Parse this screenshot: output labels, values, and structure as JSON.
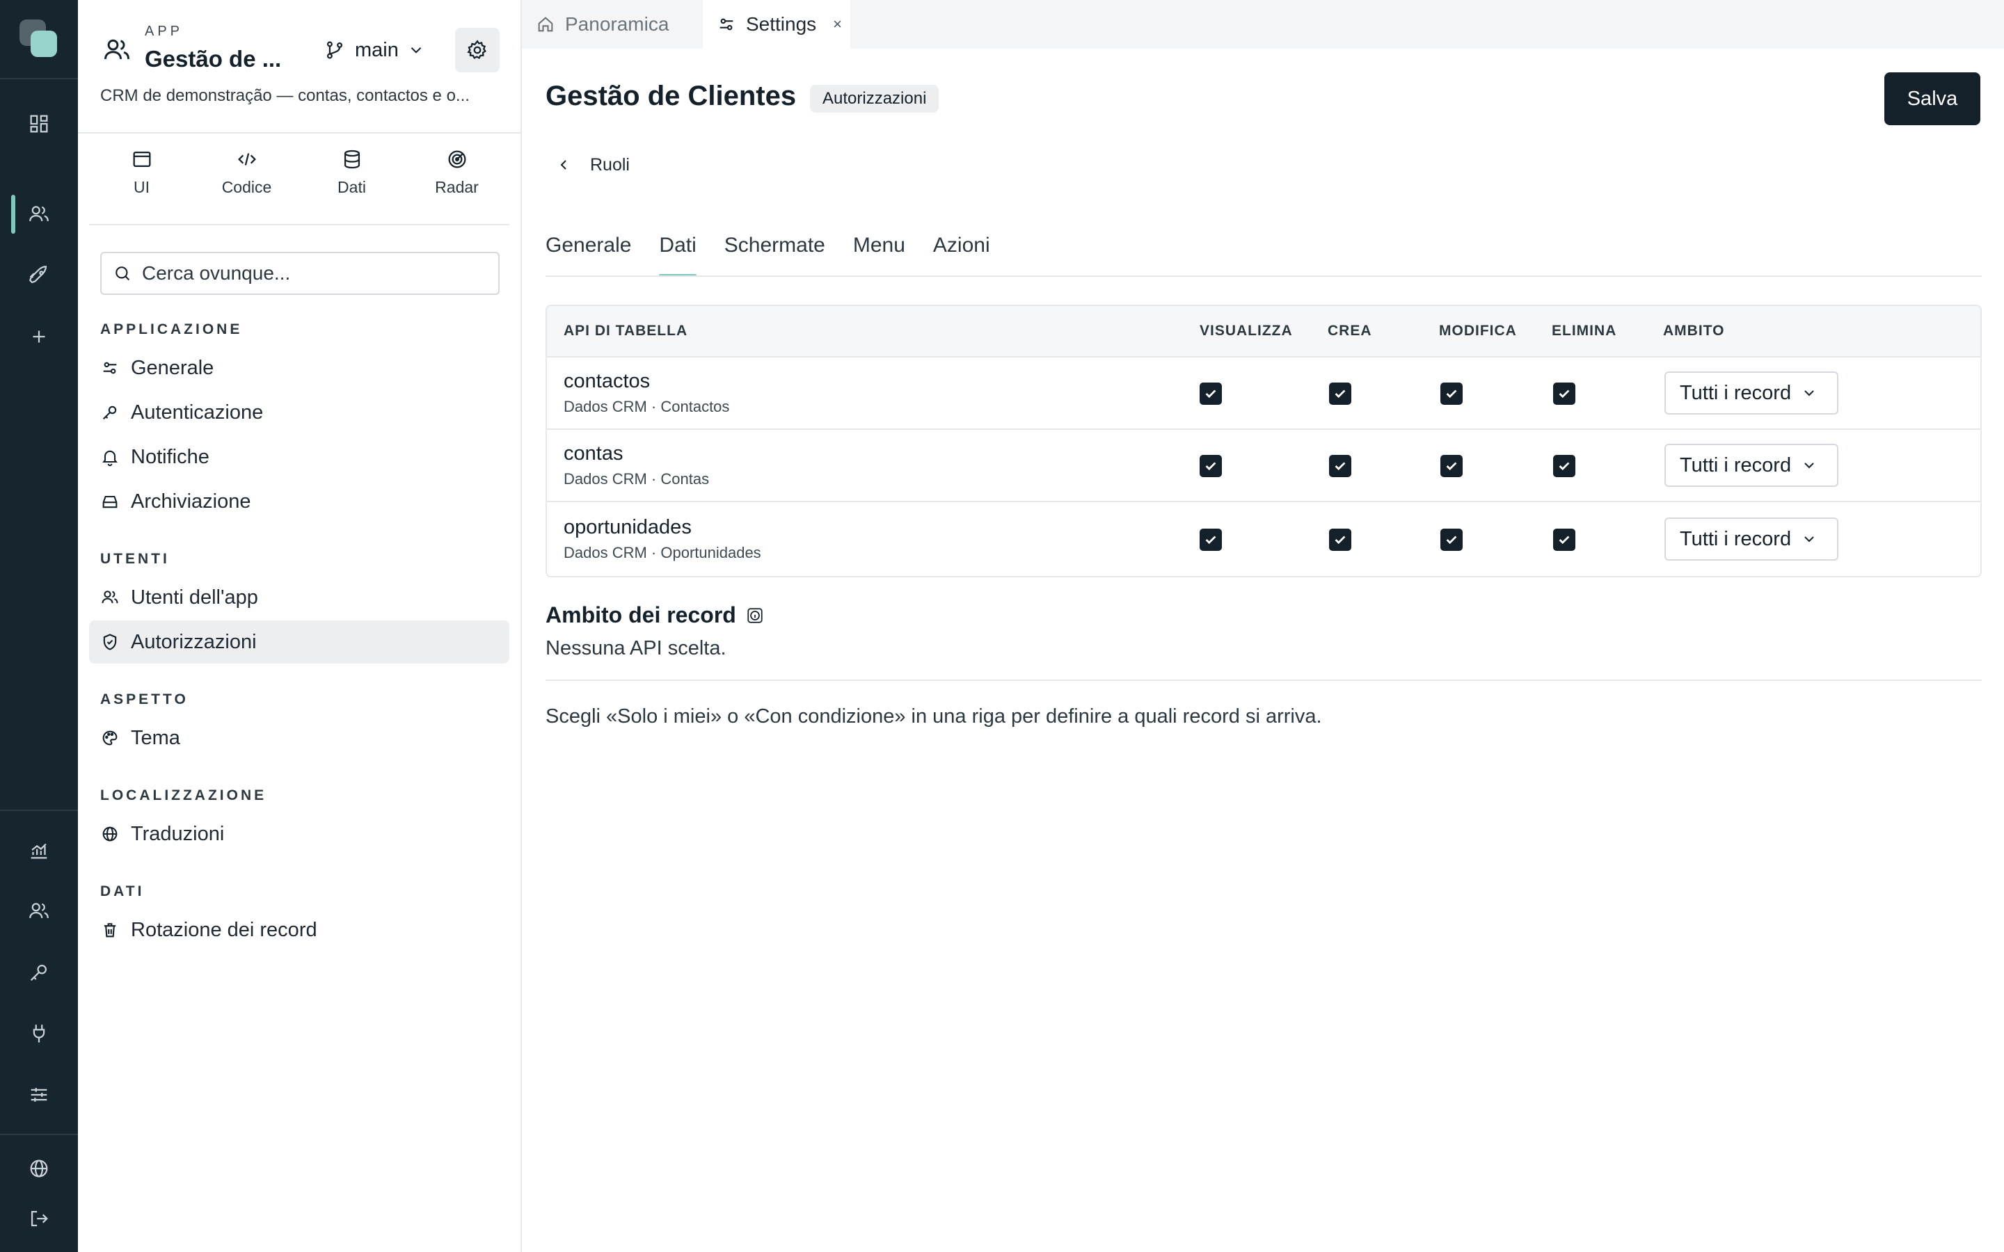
{
  "rail": {
    "icons": [
      "dashboard-icon",
      "users-icon",
      "rocket-icon",
      "plus-icon",
      "chart-icon",
      "users-icon",
      "key-icon",
      "plug-icon",
      "sliders-icon",
      "globe-icon",
      "logout-icon"
    ],
    "accent": "#7ec9bf",
    "background": "#17252e"
  },
  "sidebar": {
    "kicker": "APP",
    "app_name": "Gestão de ...",
    "branch": "main",
    "description": "CRM de demonstração — contas, contactos e o...",
    "modes": [
      {
        "label": "UI",
        "icon": "window-icon"
      },
      {
        "label": "Codice",
        "icon": "code-icon"
      },
      {
        "label": "Dati",
        "icon": "database-icon"
      },
      {
        "label": "Radar",
        "icon": "radar-icon"
      }
    ],
    "search_placeholder": "Cerca ovunque...",
    "sections": [
      {
        "title": "APPLICAZIONE",
        "items": [
          {
            "label": "Generale",
            "icon": "sliders-icon"
          },
          {
            "label": "Autenticazione",
            "icon": "key-icon"
          },
          {
            "label": "Notifiche",
            "icon": "bell-icon"
          },
          {
            "label": "Archiviazione",
            "icon": "storage-icon"
          }
        ]
      },
      {
        "title": "UTENTI",
        "items": [
          {
            "label": "Utenti dell'app",
            "icon": "users-icon"
          },
          {
            "label": "Autorizzazioni",
            "icon": "shield-icon",
            "active": true
          }
        ]
      },
      {
        "title": "ASPETTO",
        "items": [
          {
            "label": "Tema",
            "icon": "palette-icon"
          }
        ]
      },
      {
        "title": "LOCALIZZAZIONE",
        "items": [
          {
            "label": "Traduzioni",
            "icon": "globe-icon"
          }
        ]
      },
      {
        "title": "DATI",
        "items": [
          {
            "label": "Rotazione dei record",
            "icon": "trash-icon"
          }
        ]
      }
    ]
  },
  "tabs": [
    {
      "label": "Panoramica",
      "icon": "home-icon",
      "active": false
    },
    {
      "label": "Settings",
      "icon": "sliders-icon",
      "active": true,
      "close": "×"
    }
  ],
  "page": {
    "title": "Gestão de Clientes",
    "badge": "Autorizzazioni",
    "save_label": "Salva",
    "back_label": "Ruoli"
  },
  "subtabs": [
    {
      "label": "Generale",
      "active": false
    },
    {
      "label": "Dati",
      "active": true
    },
    {
      "label": "Schermate",
      "active": false
    },
    {
      "label": "Menu",
      "active": false
    },
    {
      "label": "Azioni",
      "active": false
    }
  ],
  "table": {
    "headers": [
      "API DI TABELLA",
      "VISUALIZZA",
      "CREA",
      "MODIFICA",
      "ELIMINA",
      "AMBITO"
    ],
    "rows": [
      {
        "name": "contactos",
        "sub": "Dados CRM · Contactos",
        "view": true,
        "create": true,
        "edit": true,
        "delete": true,
        "scope": "Tutti i record"
      },
      {
        "name": "contas",
        "sub": "Dados CRM · Contas",
        "view": true,
        "create": true,
        "edit": true,
        "delete": true,
        "scope": "Tutti i record"
      },
      {
        "name": "oportunidades",
        "sub": "Dados CRM · Oportunidades",
        "view": true,
        "create": true,
        "edit": true,
        "delete": true,
        "scope": "Tutti i record"
      }
    ]
  },
  "scope_section": {
    "title": "Ambito dei record",
    "empty": "Nessuna API scelta.",
    "help": "Scegli «Solo i miei» o «Con condizione» in una riga per definire a quali record si arriva."
  }
}
